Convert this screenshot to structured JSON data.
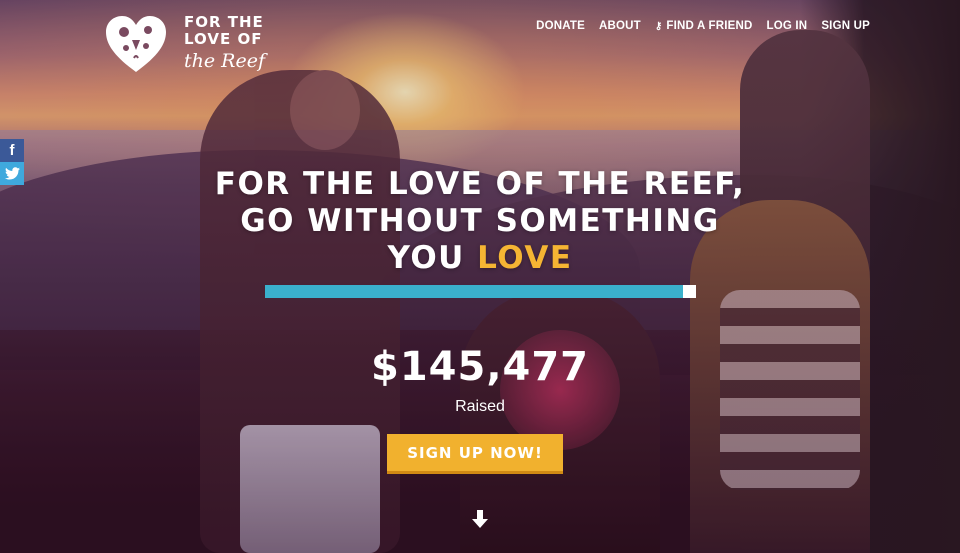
{
  "brand": {
    "line1": "FOR THE",
    "line2": "LOVE OF",
    "script": "the Reef"
  },
  "nav": {
    "items": [
      {
        "label": "DONATE"
      },
      {
        "label": "ABOUT"
      },
      {
        "label": "FIND A FRIEND",
        "icon": "key-icon"
      },
      {
        "label": "LOG IN"
      },
      {
        "label": "SIGN UP"
      }
    ]
  },
  "social": {
    "facebook": "f",
    "twitter": "t"
  },
  "hero": {
    "headline_line1": "FOR THE LOVE OF THE REEF,",
    "headline_line2": "GO WITHOUT SOMETHING",
    "headline_line3_a": "YOU",
    "headline_line3_b": "LOVE",
    "progress_fraction": 0.97,
    "amount": "$145,477",
    "raised_label": "Raised",
    "cta_label": "SIGN UP NOW!"
  },
  "colors": {
    "accent": "#f5b533",
    "progress": "#3ab0cc",
    "cta": "#f1b12e",
    "facebook": "#3b5998",
    "twitter": "#3fa9dd"
  }
}
